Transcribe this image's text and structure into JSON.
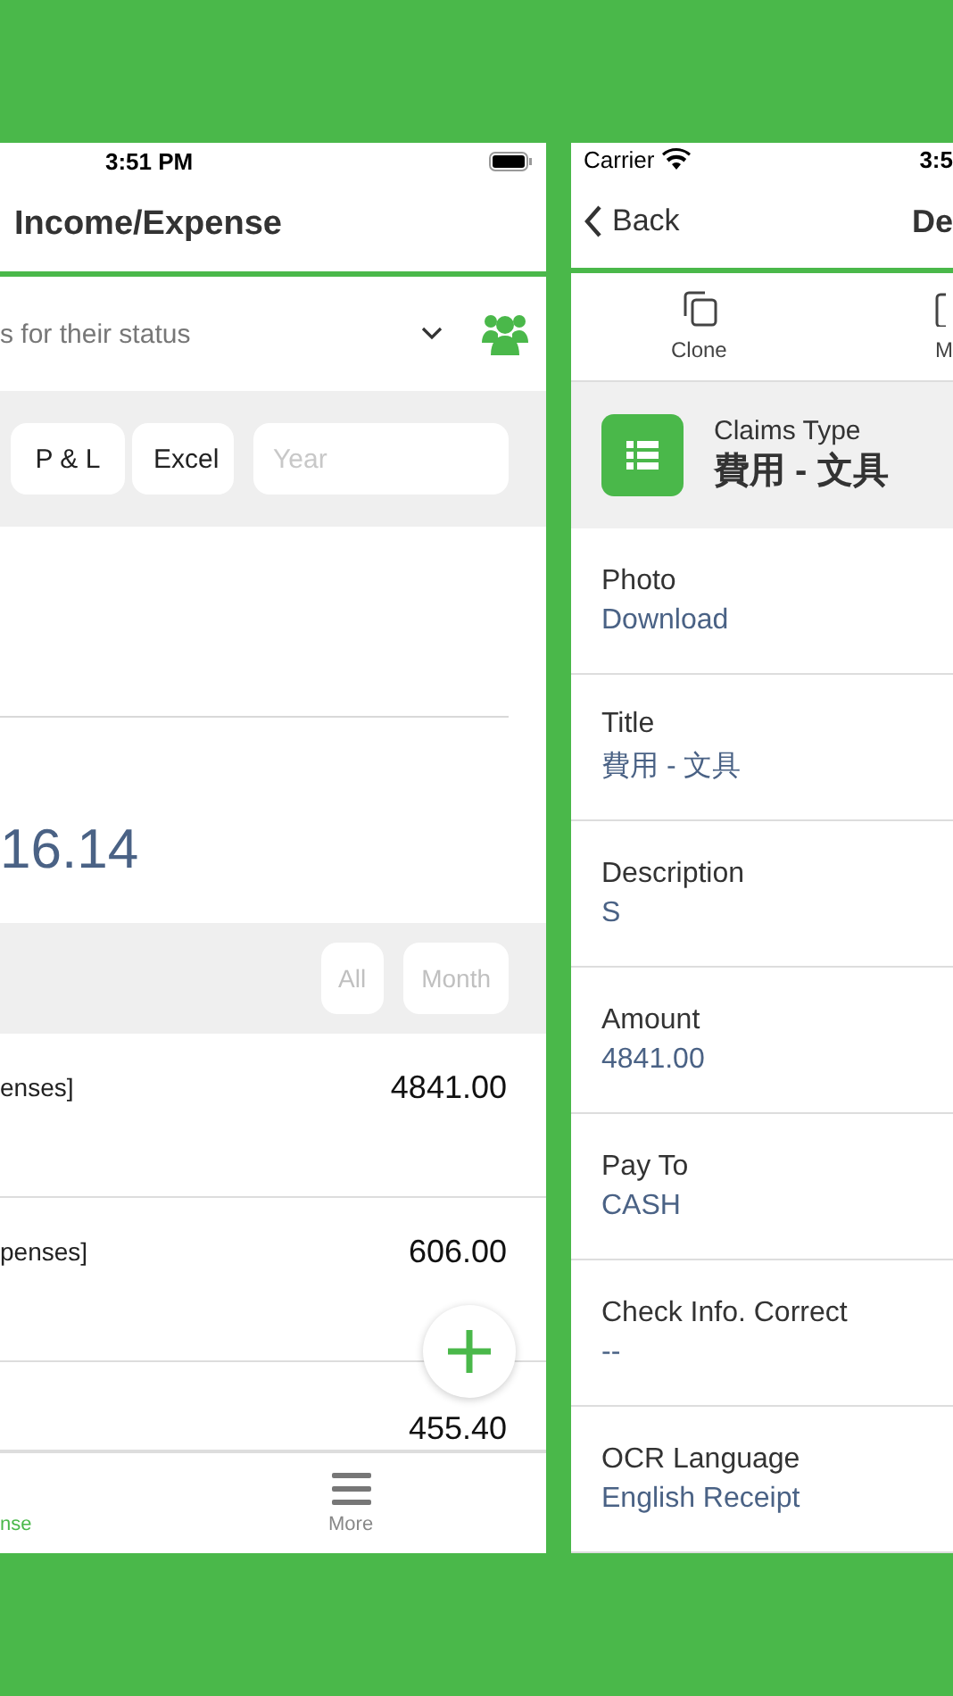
{
  "income_screen": {
    "status_time": "3:51 PM",
    "title": "Income/Expense",
    "filter": {
      "text": "s for their status"
    },
    "report_buttons": [
      "P & L",
      "Excel"
    ],
    "year_field": {
      "placeholder": "Year"
    },
    "total": "16.14",
    "period_buttons": [
      {
        "label": "All",
        "disabled": true
      },
      {
        "label": "Month",
        "disabled": true
      }
    ],
    "entries": [
      {
        "label": "enses]",
        "amount": "4841.00"
      },
      {
        "label": "penses]",
        "amount": "606.00"
      },
      {
        "amount": "455.40"
      }
    ],
    "tabs": [
      {
        "label": "nse",
        "selected": true,
        "kind": "text"
      },
      {
        "label": "More",
        "selected": false,
        "kind": "menu"
      }
    ]
  },
  "detail_screen": {
    "carrier": "Carrier",
    "status_time": "3:5",
    "back": "Back",
    "title": "De",
    "actions": [
      {
        "label": "Clone",
        "kind": "clone"
      },
      {
        "label": "M",
        "kind": "doc"
      }
    ],
    "claims_type": {
      "label": "Claims Type",
      "value": "費用 - 文具"
    },
    "fields": [
      {
        "label": "Photo",
        "value": "Download"
      },
      {
        "label": "Title",
        "value": "費用 - 文具"
      },
      {
        "label": "Description",
        "value": "S"
      },
      {
        "label": "Amount",
        "value": "4841.00"
      },
      {
        "label": "Pay To",
        "value": "CASH"
      },
      {
        "label": "Check Info. Correct",
        "value": "--"
      },
      {
        "label": "OCR Language",
        "value": "English Receipt"
      }
    ]
  }
}
